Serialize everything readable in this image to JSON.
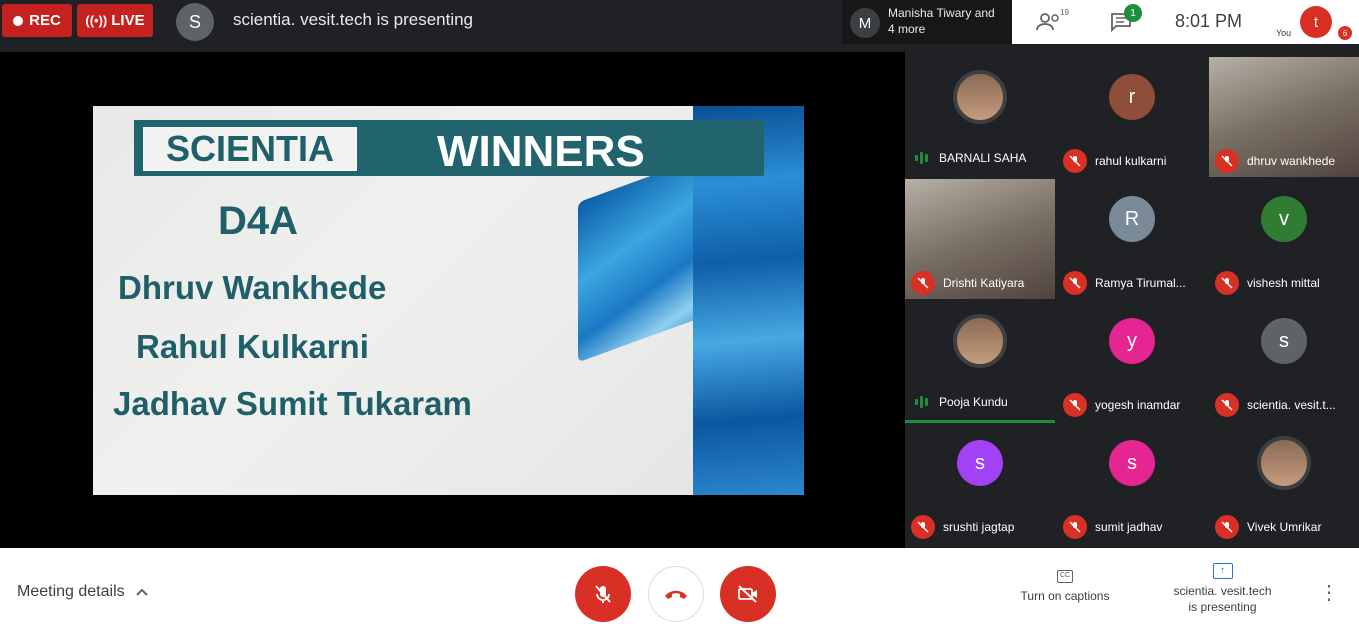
{
  "topbar": {
    "rec_label": "REC",
    "live_label": "LIVE",
    "presenter_initial": "S",
    "presenter_text": "scientia. vesit.tech is presenting",
    "joined_initial": "M",
    "joined_text": "Manisha Tiwary and 4 more",
    "people_count": "19",
    "chat_badge": "1",
    "clock": "8:01 PM",
    "you_initial": "t",
    "you_label": "You",
    "you_badge": "6"
  },
  "slide": {
    "brand": "SCIENTIA",
    "title": "WINNERS",
    "team": "D4A",
    "winners": [
      "Dhruv Wankhede",
      "Rahul Kulkarni",
      "Jadhav Sumit Tukaram"
    ]
  },
  "participants": [
    {
      "name": "BARNALI SAHA",
      "kind": "photo",
      "status": "speaking"
    },
    {
      "name": "rahul kulkarni",
      "kind": "avatar",
      "initial": "r",
      "color": "#8d4e3a",
      "status": "muted"
    },
    {
      "name": "dhruv wankhede",
      "kind": "video",
      "status": "muted"
    },
    {
      "name": "Drishti Katiyara",
      "kind": "video",
      "status": "muted"
    },
    {
      "name": "Ramya Tirumal...",
      "kind": "avatar",
      "initial": "R",
      "color": "#7a8a99",
      "status": "muted"
    },
    {
      "name": "vishesh mittal",
      "kind": "avatar",
      "initial": "v",
      "color": "#2e7d32",
      "status": "muted"
    },
    {
      "name": "Pooja Kundu",
      "kind": "photo",
      "status": "speaking"
    },
    {
      "name": "yogesh inamdar",
      "kind": "avatar",
      "initial": "y",
      "color": "#e52592",
      "status": "muted"
    },
    {
      "name": "scientia. vesit.t...",
      "kind": "avatar",
      "initial": "s",
      "color": "#5f6368",
      "status": "muted"
    },
    {
      "name": "srushti jagtap",
      "kind": "avatar",
      "initial": "s",
      "color": "#a142f4",
      "status": "muted"
    },
    {
      "name": "sumit jadhav",
      "kind": "avatar",
      "initial": "s",
      "color": "#e52592",
      "status": "muted"
    },
    {
      "name": "Vivek Umrikar",
      "kind": "photo",
      "status": "muted"
    }
  ],
  "bottom": {
    "meeting_details": "Meeting details",
    "captions_label": "Turn on captions",
    "captions_icon_text": "CC",
    "presenting_label_1": "scientia. vesit.tech",
    "presenting_label_2": "is presenting"
  },
  "colors": {
    "alert_red": "#d93025",
    "speaking_green": "#1e8e3e",
    "slide_teal": "#22646e"
  }
}
